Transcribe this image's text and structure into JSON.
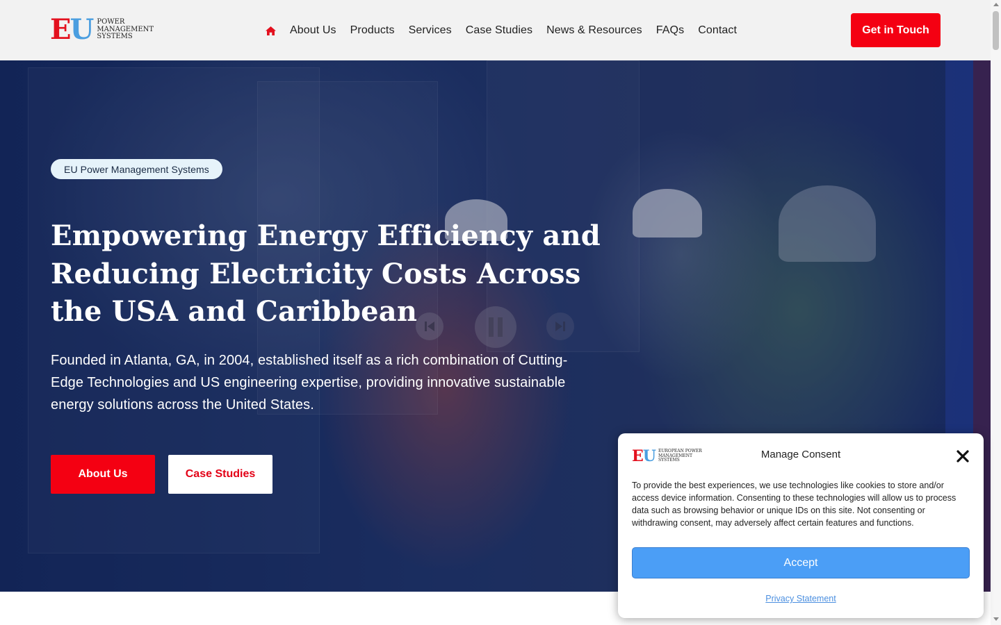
{
  "header": {
    "logo": {
      "mark_e": "E",
      "mark_u": "U",
      "line1": "POWER",
      "line2": "MANAGEMENT",
      "line3": "SYSTEMS"
    },
    "nav": [
      "About Us",
      "Products",
      "Services",
      "Case Studies",
      "News & Resources",
      "FAQs",
      "Contact"
    ],
    "cta_label": "Get in Touch",
    "home_icon": "home-icon",
    "accent_color": "#f40012"
  },
  "hero": {
    "badge": "EU Power Management Systems",
    "title": "Empowering Energy Efficiency and Reducing Electricity Costs Across the USA and Caribbean",
    "subtitle": "Founded in Atlanta, GA, in 2004, established itself as a rich combination of Cutting-Edge Technologies and US engineering expertise, providing innovative sustainable energy solutions across the United States.",
    "buttons": {
      "primary": "About Us",
      "secondary": "Case Studies"
    },
    "media_icons": [
      "previous-icon",
      "pause-icon",
      "next-icon"
    ]
  },
  "consent": {
    "logo": {
      "mark_e": "E",
      "mark_u": "U",
      "line1": "EUROPEAN POWER",
      "line2": "MANAGEMENT",
      "line3": "SYSTEMS"
    },
    "title": "Manage Consent",
    "body": "To provide the best experiences, we use technologies like cookies to store and/or access device information. Consenting to these technologies will allow us to process data such as browsing behavior or unique IDs on this site. Not consenting or withdrawing consent, may adversely affect certain features and functions.",
    "accept_label": "Accept",
    "privacy_label": "Privacy Statement",
    "accept_color": "#4b9ef6"
  }
}
